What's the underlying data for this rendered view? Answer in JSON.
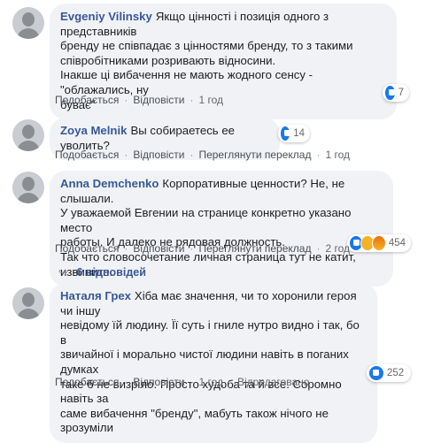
{
  "actions": {
    "like": "Подобається",
    "reply": "Відповісти",
    "translate": "Переглянути переклад",
    "translated": "Відредаговано"
  },
  "comments": [
    {
      "author": "Evgeniy Vilinsky",
      "lines": [
        "Якщо цінності і позиція одного з представників",
        "бренду не співпадає з цінностями бренду, то з такими",
        "співробітниками розривають відносини.",
        "Інакше ці вибачення не мають жодного сенсу - \"облажались, ну",
        "буває\""
      ],
      "time": "1 год",
      "reactions": "7"
    },
    {
      "author": "Zoya Melnik",
      "lines": [
        "Вы собираетесь ее уволить?"
      ],
      "time": "1 год",
      "reactions": "14"
    },
    {
      "author": "Anna Demchenko",
      "lines": [
        "Корпоративные ценности? Не, не слышали.",
        "У уважаемой Евгении на странице конкретно указано место",
        "работы. И далеко не рядовая должность.",
        "Так что словосочетание личная страница тут не катит, извините."
      ],
      "time": "2 год",
      "reactions": "454",
      "replies": "6 відповідей"
    },
    {
      "author": "Наталя Грех",
      "lines": [
        "Хіба має значення, чи то хоронили героя чи іншу",
        "невідому їй людину. Її суть і гниле нутро видно і так, бо в",
        "звичайної і морально чистої людини навіть в поганих думках",
        "таке б не визріло. Просто худоба та й все. Соромно навіть за",
        "саме вибачення \"бренду\", мабуть також нічого не зрозуміли"
      ],
      "time": "1 год",
      "reactions": "252"
    }
  ]
}
